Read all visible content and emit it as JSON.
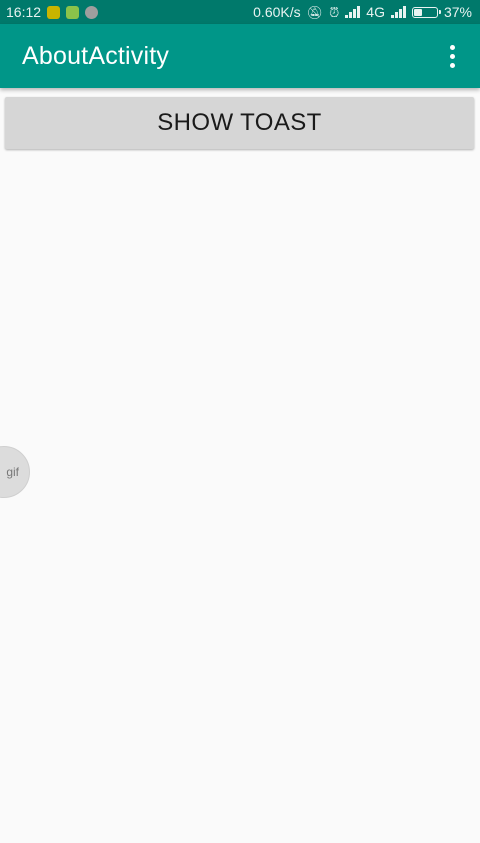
{
  "status_bar": {
    "time": "16:12",
    "network_speed": "0.60K/s",
    "network_type": "4G",
    "battery_percent_text": "37%",
    "battery_level": 0.37,
    "notification_icons": [
      "app-notification-icon",
      "chat-notification-icon",
      "browser-notification-icon"
    ],
    "system_icons": [
      "mute-icon",
      "alarm-icon",
      "signal-icon",
      "signal-icon",
      "battery-icon"
    ]
  },
  "app_bar": {
    "title": "AboutActivity",
    "menu_icon": "overflow-menu-icon"
  },
  "main": {
    "button_label": "SHOW TOAST"
  },
  "floating_badge": {
    "label": "gif"
  },
  "colors": {
    "status_bar": "#00796b",
    "app_bar": "#009688",
    "background": "#fafafa",
    "button": "#d6d6d6"
  }
}
